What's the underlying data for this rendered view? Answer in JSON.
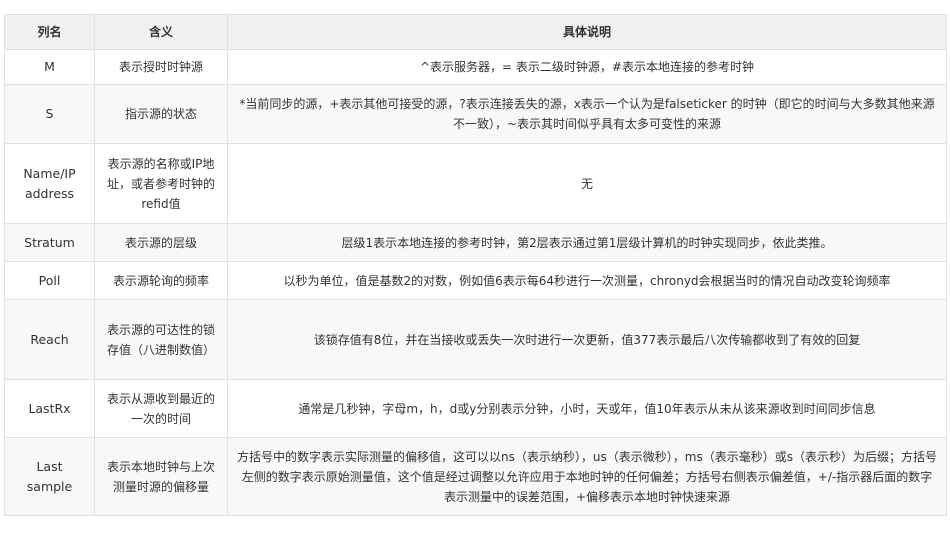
{
  "table": {
    "headers": [
      "列名",
      "含义",
      "具体说明"
    ],
    "rows": [
      {
        "name": "M",
        "meaning": "表示授时时钟源",
        "detail": "^表示服务器，= 表示二级时钟源，#表示本地连接的参考时钟"
      },
      {
        "name": "S",
        "meaning": "指示源的状态",
        "detail": "*当前同步的源，+表示其他可接受的源，?表示连接丢失的源，x表示一个认为是falseticker 的时钟（即它的时间与大多数其他来源不一致），~表示其时间似乎具有太多可变性的来源"
      },
      {
        "name": "Name/IP address",
        "meaning": "表示源的名称或IP地址，或者参考时钟的refid值",
        "detail": "无"
      },
      {
        "name": "Stratum",
        "meaning": "表示源的层级",
        "detail": "层级1表示本地连接的参考时钟，第2层表示通过第1层级计算机的时钟实现同步，依此类推。"
      },
      {
        "name": "Poll",
        "meaning": "表示源轮询的频率",
        "detail": "以秒为单位，值是基数2的对数，例如值6表示每64秒进行一次测量，chronyd会根据当时的情况自动改变轮询频率"
      },
      {
        "name": "Reach",
        "meaning": "表示源的可达性的锁存值（八进制数值）",
        "detail": "该锁存值有8位，并在当接收或丢失一次时进行一次更新，值377表示最后八次传输都收到了有效的回复"
      },
      {
        "name": "LastRx",
        "meaning": "表示从源收到最近的一次的时间",
        "detail": "通常是几秒钟，字母m，h，d或y分别表示分钟，小时，天或年，值10年表示从未从该来源收到时间同步信息"
      },
      {
        "name": "Last sample",
        "meaning": "表示本地时钟与上次测量时源的偏移量",
        "detail": "方括号中的数字表示实际测量的偏移值，这可以以ns（表示纳秒），us（表示微秒），ms（表示毫秒）或s（表示秒）为后缀；方括号左侧的数字表示原始测量值，这个值是经过调整以允许应用于本地时钟的任何偏差；方括号右侧表示偏差值，+/-指示器后面的数字表示测量中的误差范围，+偏移表示本地时钟快速来源"
      }
    ]
  }
}
